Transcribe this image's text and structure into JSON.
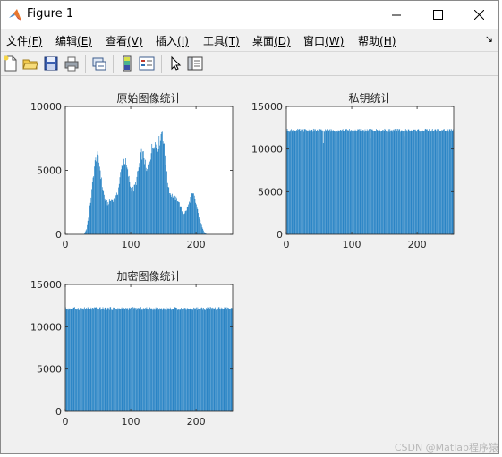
{
  "window": {
    "title": "Figure 1",
    "icon": "matlab-icon",
    "controls": [
      "minimize-icon",
      "maximize-icon",
      "close-icon"
    ]
  },
  "menu": {
    "items": [
      {
        "label": "文件",
        "key": "(F)"
      },
      {
        "label": "编辑",
        "key": "(E)"
      },
      {
        "label": "查看",
        "key": "(V)"
      },
      {
        "label": "插入",
        "key": "(I)"
      },
      {
        "label": "工具",
        "key": "(T)"
      },
      {
        "label": "桌面",
        "key": "(D)"
      },
      {
        "label": "窗口",
        "key": "(W)"
      },
      {
        "label": "帮助",
        "key": "(H)"
      }
    ],
    "overflow": "↘"
  },
  "toolbar": {
    "icons": [
      "new-figure-icon",
      "open-file-icon",
      "save-icon",
      "print-icon",
      "link-plot-icon",
      "colorbar-icon",
      "legend-icon",
      "edit-plot-icon",
      "property-inspector-icon"
    ]
  },
  "colors": {
    "bar": "#1f7ec2",
    "axes_bg": "#ffffff",
    "figure_bg": "#f0f0f0"
  },
  "chart_data": [
    {
      "type": "bar",
      "title": "原始图像统计",
      "xlabel": "",
      "ylabel": "",
      "xlim": [
        0,
        256
      ],
      "ylim": [
        0,
        10000
      ],
      "xticks": [
        0,
        100,
        200
      ],
      "yticks": [
        0,
        5000,
        10000
      ],
      "x": [
        0,
        10,
        20,
        28,
        32,
        36,
        40,
        44,
        48,
        52,
        56,
        60,
        64,
        68,
        72,
        76,
        80,
        84,
        88,
        92,
        96,
        100,
        104,
        108,
        112,
        116,
        120,
        124,
        128,
        132,
        136,
        140,
        144,
        148,
        152,
        156,
        160,
        164,
        168,
        172,
        176,
        180,
        184,
        188,
        192,
        196,
        200,
        204,
        208,
        212,
        216,
        220,
        224,
        228,
        232,
        236,
        240,
        250,
        255
      ],
      "values": [
        0,
        0,
        0,
        0,
        400,
        1700,
        3400,
        5300,
        6300,
        5400,
        3800,
        2800,
        2400,
        2600,
        2700,
        2800,
        3300,
        4700,
        5900,
        5600,
        4600,
        3600,
        3500,
        4100,
        5200,
        6300,
        6100,
        4800,
        5700,
        6700,
        7300,
        6700,
        7400,
        8200,
        6200,
        4100,
        3200,
        3000,
        2800,
        2700,
        2100,
        1600,
        1800,
        2300,
        3000,
        3100,
        2300,
        1400,
        700,
        200,
        0,
        0,
        0,
        0,
        0,
        0,
        0,
        0,
        0
      ]
    },
    {
      "type": "bar",
      "title": "私钥统计",
      "xlabel": "",
      "ylabel": "",
      "xlim": [
        0,
        256
      ],
      "ylim": [
        0,
        15000
      ],
      "xticks": [
        0,
        100,
        200
      ],
      "yticks": [
        0,
        5000,
        10000,
        15000
      ],
      "approx_value": 12200,
      "dips": [
        [
          56,
          10700
        ],
        [
          128,
          11300
        ],
        [
          180,
          11500
        ]
      ]
    },
    {
      "type": "bar",
      "title": "加密图像统计",
      "xlabel": "",
      "ylabel": "",
      "xlim": [
        0,
        256
      ],
      "ylim": [
        0,
        15000
      ],
      "xticks": [
        0,
        100,
        200
      ],
      "yticks": [
        0,
        5000,
        10000,
        15000
      ],
      "approx_value": 12150,
      "dips": []
    }
  ],
  "watermark": "CSDN @Matlab程序猿"
}
